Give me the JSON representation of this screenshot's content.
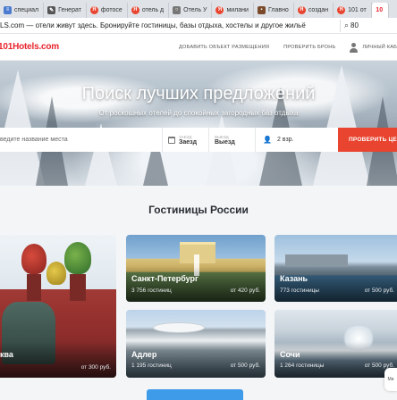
{
  "browser": {
    "tabs": [
      {
        "label": "специал",
        "icon": "doc-icon",
        "color": "#4a7bd0"
      },
      {
        "label": "Генерат",
        "icon": "pen-icon",
        "color": "#555555"
      },
      {
        "label": "фотосе",
        "icon": "yandex-icon",
        "color": "#e8442f"
      },
      {
        "label": "отель д",
        "icon": "yandex-icon",
        "color": "#e8442f"
      },
      {
        "label": "Отель У",
        "icon": "search-icon",
        "color": "#777777"
      },
      {
        "label": "милани",
        "icon": "yandex-icon",
        "color": "#e8442f"
      },
      {
        "label": "Главно",
        "icon": "site-icon",
        "color": "#7a4a2a"
      },
      {
        "label": "создан",
        "icon": "yandex-icon",
        "color": "#e8442f"
      },
      {
        "label": "101 от",
        "icon": "yandex-icon",
        "color": "#e8442f"
      },
      {
        "label": "10",
        "icon": "hotels-icon",
        "color": "#e8242c"
      }
    ],
    "page_title": "LS.com — отели живут здесь. Бронируйте гостиницы, базы отдыха, хостелы и другое жильё",
    "search_value": "80"
  },
  "header": {
    "logo": "101Hotels.com",
    "add_property": "ДОБАВИТЬ ОБЪЕКТ РАЗМЕЩЕНИЯ",
    "check_booking": "ПРОВЕРИТЬ БРОНЬ",
    "cabinet": "ЛИЧНЫЙ КАБ"
  },
  "hero": {
    "title": "Поиск лучших предложений",
    "subtitle": "От роскошных отелей до спокойных загородных баз отдыха"
  },
  "search": {
    "place_placeholder": "ведите название места",
    "checkin_small": "ЗАЕЗД",
    "checkin_label": "Заезд",
    "checkout_small": "ВЫЕЗД",
    "checkout_label": "Выезд",
    "guests": "2 взр.",
    "submit": "ПРОВЕРИТЬ ЦЕН"
  },
  "section": {
    "title": "Гостиницы России"
  },
  "cities": [
    {
      "name": "ква",
      "count": "",
      "price": "от 300 руб."
    },
    {
      "name": "Санкт-Петербург",
      "count": "3 756 гостиниц",
      "price": "от 420 руб."
    },
    {
      "name": "Казань",
      "count": "773 гостиницы",
      "price": "от 500 руб."
    },
    {
      "name": "Адлер",
      "count": "1 195 гостиниц",
      "price": "от 500 руб."
    },
    {
      "name": "Сочи",
      "count": "1 264 гостиницы",
      "price": "от 500 руб."
    }
  ],
  "help": "Ми"
}
